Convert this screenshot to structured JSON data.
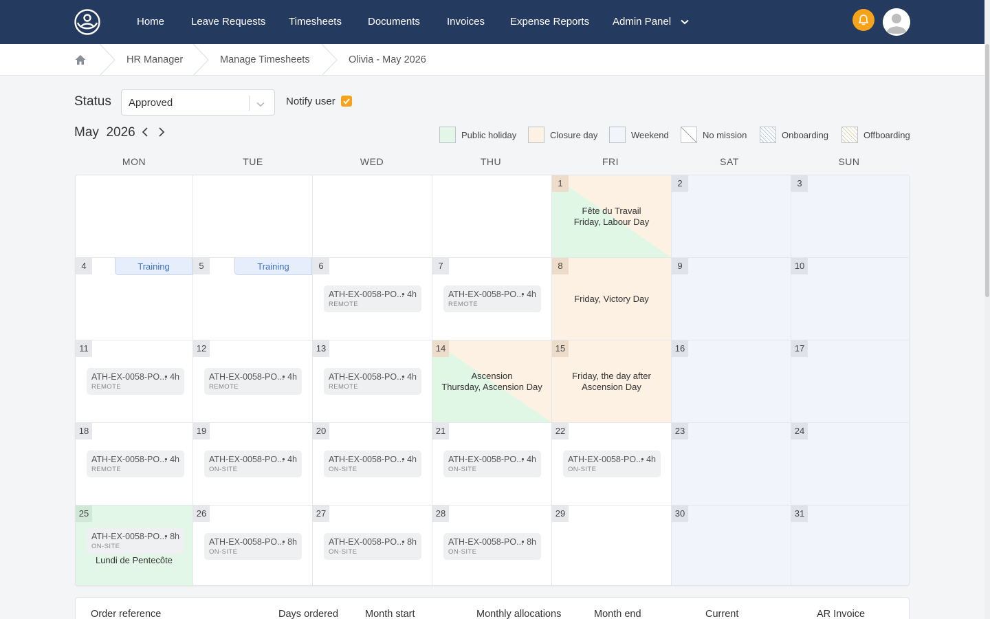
{
  "nav": {
    "items": [
      {
        "label": "Home",
        "name": "nav-home"
      },
      {
        "label": "Leave Requests",
        "name": "nav-leave-requests"
      },
      {
        "label": "Timesheets",
        "name": "nav-timesheets"
      },
      {
        "label": "Documents",
        "name": "nav-documents"
      },
      {
        "label": "Invoices",
        "name": "nav-invoices"
      },
      {
        "label": "Expense Reports",
        "name": "nav-expense-reports"
      },
      {
        "label": "Admin Panel",
        "name": "nav-admin-panel"
      }
    ],
    "accent": "#243a5e",
    "bell_color": "#f7a21b",
    "icons": {
      "logo": "people-circle-logo",
      "bell": "bell-icon",
      "avatar": "user-avatar-icon",
      "dropdown": "chevron-down-icon"
    }
  },
  "breadcrumb": [
    "HR Manager",
    "Manage Timesheets",
    "Olivia - May 2026"
  ],
  "status": {
    "label": "Status",
    "value": "Approved",
    "notify_label": "Notify user",
    "notify_checked": true
  },
  "calendar": {
    "month": "May",
    "year": "2026",
    "weekdays": [
      "MON",
      "TUE",
      "WED",
      "THU",
      "FRI",
      "SAT",
      "SUN"
    ],
    "legend": [
      {
        "label": "Public holiday",
        "color": "#e3f7e8"
      },
      {
        "label": "Closure day",
        "color": "#fdf1e3"
      },
      {
        "label": "Weekend",
        "color": "#f1f5fb"
      },
      {
        "label": "No mission",
        "color": "#ffffff"
      },
      {
        "label": "Onboarding",
        "color": "#dde6f3"
      },
      {
        "label": "Offboarding",
        "color": "#f1ecd9"
      }
    ],
    "mission_code": "ATH-EX-0058-PO...",
    "days": {
      "1": {
        "label_lines": [
          "Fête du Travail",
          "Friday, Labour Day"
        ]
      },
      "4": {
        "training": "Training"
      },
      "5": {
        "training": "Training"
      },
      "6": {
        "hours": "• 4h",
        "location": "REMOTE"
      },
      "7": {
        "hours": "• 4h",
        "location": "REMOTE"
      },
      "8": {
        "label_lines": [
          "Friday, Victory Day"
        ]
      },
      "11": {
        "hours": "• 4h",
        "location": "REMOTE"
      },
      "12": {
        "hours": "• 4h",
        "location": "REMOTE"
      },
      "13": {
        "hours": "• 4h",
        "location": "REMOTE"
      },
      "14": {
        "label_lines": [
          "Ascension",
          "Thursday, Ascension Day"
        ]
      },
      "15": {
        "label_lines": [
          "Friday, the day after",
          "Ascension Day"
        ]
      },
      "18": {
        "hours": "• 4h",
        "location": "REMOTE"
      },
      "19": {
        "hours": "• 4h",
        "location": "ON-SITE"
      },
      "20": {
        "hours": "• 4h",
        "location": "ON-SITE"
      },
      "21": {
        "hours": "• 4h",
        "location": "ON-SITE"
      },
      "22": {
        "hours": "• 4h",
        "location": "ON-SITE"
      },
      "25": {
        "hours": "• 8h",
        "location": "ON-SITE",
        "label_lines": [
          "Lundi de Pentecôte"
        ]
      },
      "26": {
        "hours": "• 8h",
        "location": "ON-SITE"
      },
      "27": {
        "hours": "• 8h",
        "location": "ON-SITE"
      },
      "28": {
        "hours": "• 8h",
        "location": "ON-SITE"
      }
    }
  },
  "table": {
    "headers": [
      "Order reference",
      "Days ordered",
      "Month start",
      "Monthly allocations",
      "Month end",
      "Current",
      "AR Invoice"
    ]
  }
}
